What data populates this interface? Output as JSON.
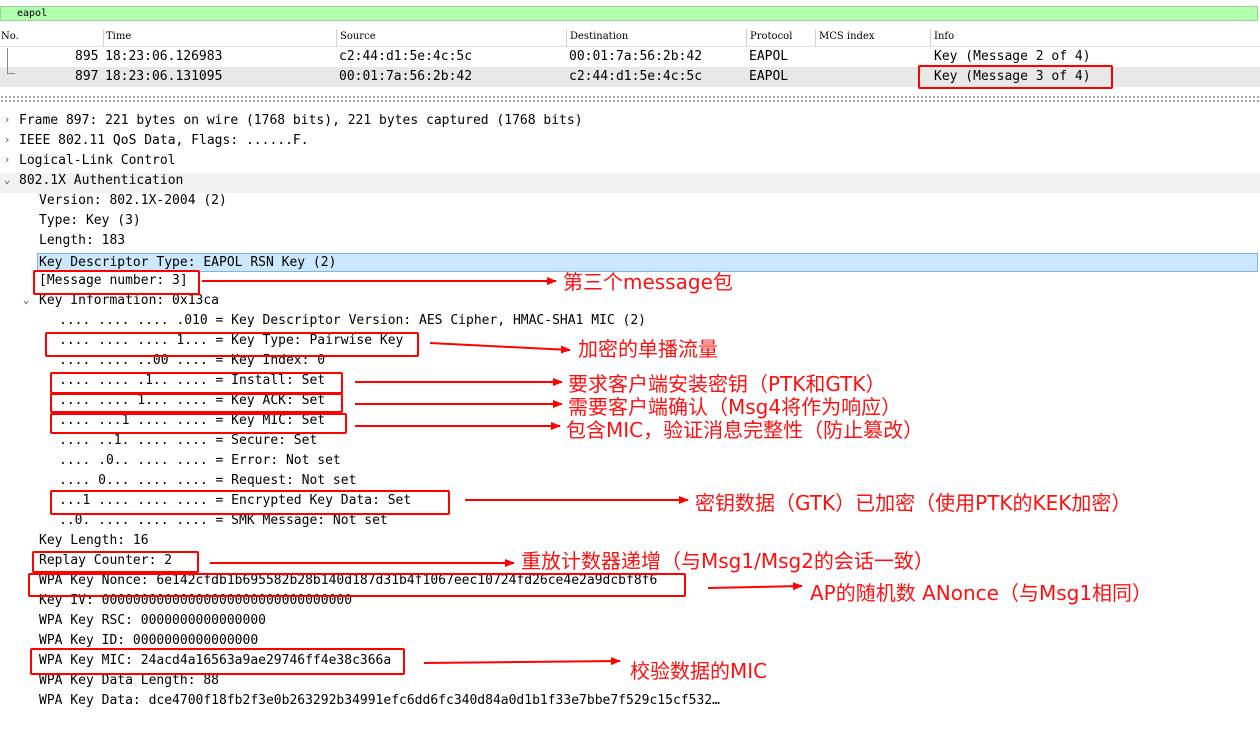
{
  "filter": {
    "value": "eapol"
  },
  "columns": {
    "no": "No.",
    "time": "Time",
    "source": "Source",
    "destination": "Destination",
    "protocol": "Protocol",
    "mcs_index": "MCS index",
    "info": "Info"
  },
  "packets": [
    {
      "no": "895",
      "time": "18:23:06.126983",
      "source": "c2:44:d1:5e:4c:5c",
      "destination": "00:01:7a:56:2b:42",
      "protocol": "EAPOL",
      "info": "Key (Message 2 of 4)"
    },
    {
      "no": "897",
      "time": "18:23:06.131095",
      "source": "00:01:7a:56:2b:42",
      "destination": "c2:44:d1:5e:4c:5c",
      "protocol": "EAPOL",
      "info": "Key (Message 3 of 4)"
    }
  ],
  "details": {
    "frame": "Frame 897: 221 bytes on wire (1768 bits), 221 bytes captured (1768 bits)",
    "ieee": "IEEE 802.11 QoS Data, Flags: ......F.",
    "llc": "Logical-Link Control",
    "auth": "802.1X Authentication",
    "version": "Version: 802.1X-2004 (2)",
    "type": "Type: Key (3)",
    "length": "Length: 183",
    "key_descriptor_type": "Key Descriptor Type: EAPOL RSN Key (2)",
    "message_number": "[Message number: 3]",
    "key_information": "Key Information: 0x13ca",
    "kdv": ".... .... .... .010 = Key Descriptor Version: AES Cipher, HMAC-SHA1 MIC (2)",
    "key_type": ".... .... .... 1... = Key Type: Pairwise Key",
    "key_index": ".... .... ..00 .... = Key Index: 0",
    "install": ".... .... .1.. .... = Install: Set",
    "key_ack": ".... .... 1... .... = Key ACK: Set",
    "key_mic_flag": ".... ...1 .... .... = Key MIC: Set",
    "secure": ".... ..1. .... .... = Secure: Set",
    "error": ".... .0.. .... .... = Error: Not set",
    "request": ".... 0... .... .... = Request: Not set",
    "encrypted": "...1 .... .... .... = Encrypted Key Data: Set",
    "smk": "..0. .... .... .... = SMK Message: Not set",
    "key_length": "Key Length: 16",
    "replay_counter": "Replay Counter: 2",
    "nonce": "WPA Key Nonce: 6e142cfdb1b695582b28b140d187d31b4f1067eec10724fd26ce4e2a9dcbf8f6",
    "key_iv": "Key IV: 00000000000000000000000000000000",
    "key_rsc": "WPA Key RSC: 0000000000000000",
    "key_id": "WPA Key ID: 0000000000000000",
    "key_mic": "WPA Key MIC: 24acd4a16563a9ae29746ff4e38c366a",
    "key_data_length": "WPA Key Data Length: 88",
    "key_data": "WPA Key Data: dce4700f18fb2f3e0b263292b34991efc6dd6fc340d84a0d1b1f33e7bbe7f529c15cf532…"
  },
  "annotations": {
    "message3": "第三个message包",
    "pairwise": "加密的单播流量",
    "install": "要求客户端安装密钥（PTK和GTK）",
    "ack": "需要客户端确认（Msg4将作为响应）",
    "mic": "包含MIC，验证消息完整性（防止篡改）",
    "encrypted": "密钥数据（GTK）已加密（使用PTK的KEK加密）",
    "replay": "重放计数器递增（与Msg1/Msg2的会话一致）",
    "nonce": "AP的随机数 ANonce（与Msg1相同）",
    "keymic": "校验数据的MIC"
  },
  "colors": {
    "filter_bg": "#afffaf",
    "selected_row": "#e8e8e8",
    "highlight": "#cce8ff",
    "annotation": "#ff0000"
  },
  "icons": {
    "bookmark": "bookmark-icon",
    "expand": "chevron-right-icon",
    "collapse": "chevron-down-icon"
  }
}
